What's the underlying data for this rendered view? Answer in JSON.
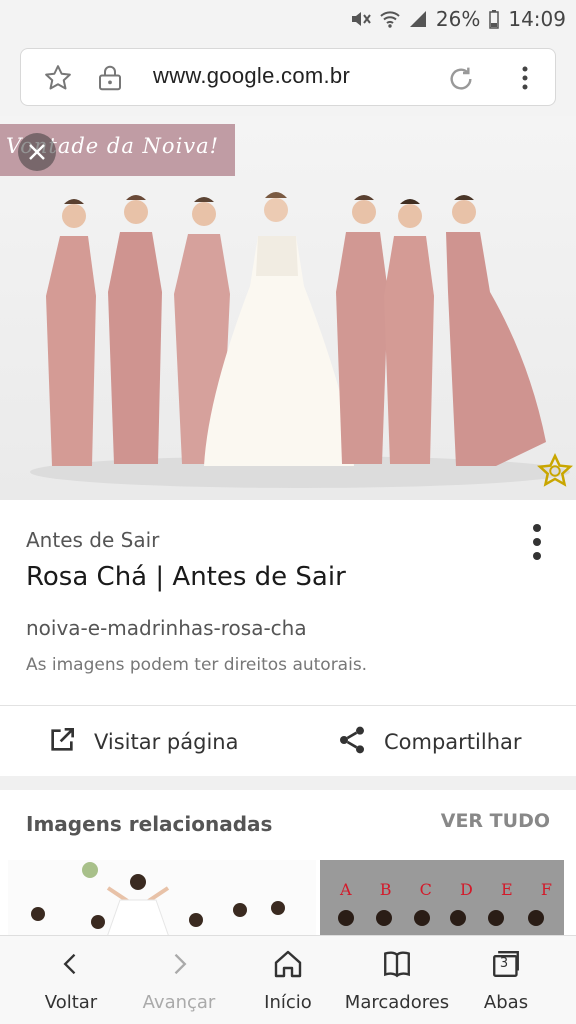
{
  "status_bar": {
    "icons": [
      "mute-icon",
      "wifi-icon",
      "signal-icon",
      "battery-icon"
    ],
    "battery": "26%",
    "time": "14:09"
  },
  "url_bar": {
    "url": "www.google.com.br",
    "icons": [
      "star-icon",
      "lock-icon",
      "reload-icon",
      "more-vert-icon"
    ]
  },
  "hero": {
    "watermark_text": "Vontade da Noiva!",
    "close_icon": "close-icon",
    "badge_icon": "star-badge-icon"
  },
  "result": {
    "source": "Antes de Sair",
    "title": "Rosa Chá | Antes de Sair",
    "filename": "noiva-e-madrinhas-rosa-cha",
    "copyright_note": "As imagens podem ter direitos autorais.",
    "actions": [
      {
        "label": "Visitar página",
        "icon": "open-in-new-icon"
      },
      {
        "label": "Compartilhar",
        "icon": "share-icon"
      }
    ]
  },
  "related": {
    "title": "Imagens relacionadas",
    "see_all": "VER TUDO",
    "letters": [
      "A",
      "B",
      "C",
      "D",
      "E",
      "F"
    ]
  },
  "bottom_nav": [
    {
      "label": "Voltar",
      "icon": "chevron-left-icon",
      "enabled": true
    },
    {
      "label": "Avançar",
      "icon": "chevron-right-icon",
      "enabled": false
    },
    {
      "label": "Início",
      "icon": "home-icon",
      "enabled": true
    },
    {
      "label": "Marcadores",
      "icon": "bookmarks-icon",
      "enabled": true
    },
    {
      "label": "Abas",
      "icon": "tabs-icon",
      "enabled": true,
      "badge": "3"
    }
  ],
  "colors": {
    "dress_pink": "#d49b95",
    "watermark_bg": "#c09ca4",
    "letter_red": "#d31a2a"
  }
}
